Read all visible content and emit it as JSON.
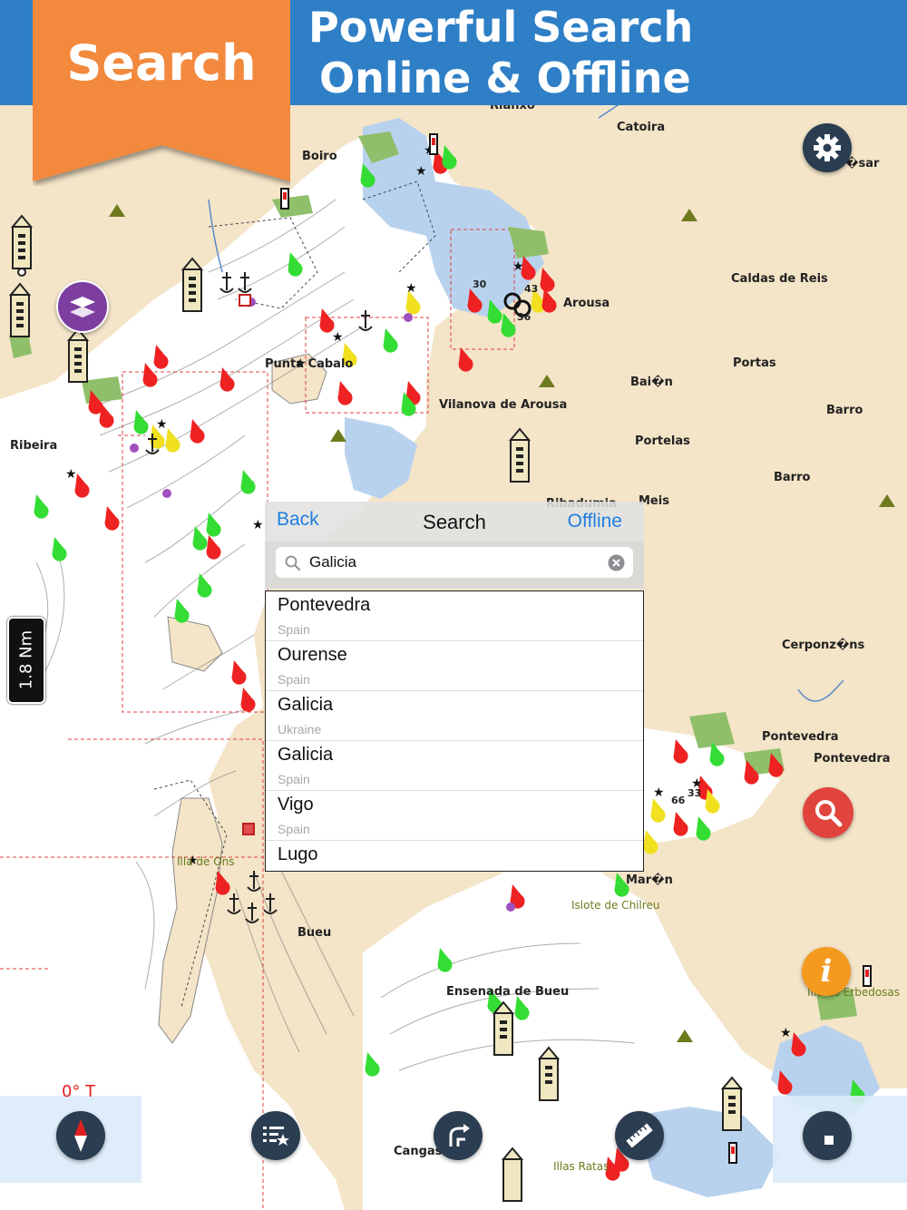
{
  "banner": {
    "ribbon_label": "Search",
    "headline_line1": "Powerful Search",
    "headline_line2": "Online & Offline",
    "color": "#2e7fc6",
    "ribbon_color": "#f2893e"
  },
  "map": {
    "places": [
      {
        "id": "rianxo",
        "label": "Rianxo"
      },
      {
        "id": "catoira",
        "label": "Catoira"
      },
      {
        "id": "boiro",
        "label": "Boiro"
      },
      {
        "id": "vsar",
        "label": "�sar"
      },
      {
        "id": "caldas",
        "label": "Caldas de Reis"
      },
      {
        "id": "arousa",
        "label": "Arousa"
      },
      {
        "id": "portas",
        "label": "Portas"
      },
      {
        "id": "puntacabalo",
        "label": "Punta Cabalo"
      },
      {
        "id": "baion",
        "label": "Bai�n"
      },
      {
        "id": "vilanova",
        "label": "Vilanova de Arousa"
      },
      {
        "id": "barro1",
        "label": "Barro"
      },
      {
        "id": "portelas",
        "label": "Portelas"
      },
      {
        "id": "ribeira",
        "label": "Ribeira"
      },
      {
        "id": "barro2",
        "label": "Barro"
      },
      {
        "id": "ribadumia",
        "label": "Ribadumia"
      },
      {
        "id": "meis",
        "label": "Meis"
      },
      {
        "id": "cerponzons",
        "label": "Cerponz�ns"
      },
      {
        "id": "pontevedra1",
        "label": "Pontevedra"
      },
      {
        "id": "pontevedra2",
        "label": "Pontevedra"
      },
      {
        "id": "illadeons",
        "label": "Illa de Ons"
      },
      {
        "id": "maron",
        "label": "Mar�n"
      },
      {
        "id": "chilreu",
        "label": "Islote de Chilreu"
      },
      {
        "id": "bueu",
        "label": "Bueu"
      },
      {
        "id": "ensenada",
        "label": "Ensenada de Bueu"
      },
      {
        "id": "erbedosas",
        "label": "Illotes Erbedosas"
      },
      {
        "id": "cangas",
        "label": "Cangas"
      },
      {
        "id": "illasratas",
        "label": "Illas Ratas"
      }
    ],
    "depths": [
      "30",
      "43",
      "36",
      "66",
      "33"
    ],
    "scale_label": "1.8 Nm",
    "heading_label": "0° T"
  },
  "search": {
    "back_label": "Back",
    "title": "Search",
    "offline_label": "Offline",
    "query": "Galicia",
    "results": [
      {
        "title": "Pontevedra",
        "subtitle": "Spain"
      },
      {
        "title": "Ourense",
        "subtitle": "Spain"
      },
      {
        "title": "Galicia",
        "subtitle": "Ukraine"
      },
      {
        "title": "Galicia",
        "subtitle": "Spain"
      },
      {
        "title": "Vigo",
        "subtitle": "Spain"
      },
      {
        "title": "Lugo",
        "subtitle": ""
      }
    ]
  },
  "colors": {
    "water": "#b8d2ee",
    "land": "#f4e4c8",
    "shallow": "#ffffff",
    "accent_blue": "#1f7fe0",
    "button_dark": "#2b3d50",
    "layers_purple": "#7d3ea0",
    "search_red": "#e0443c",
    "info_orange": "#f39a1f"
  }
}
